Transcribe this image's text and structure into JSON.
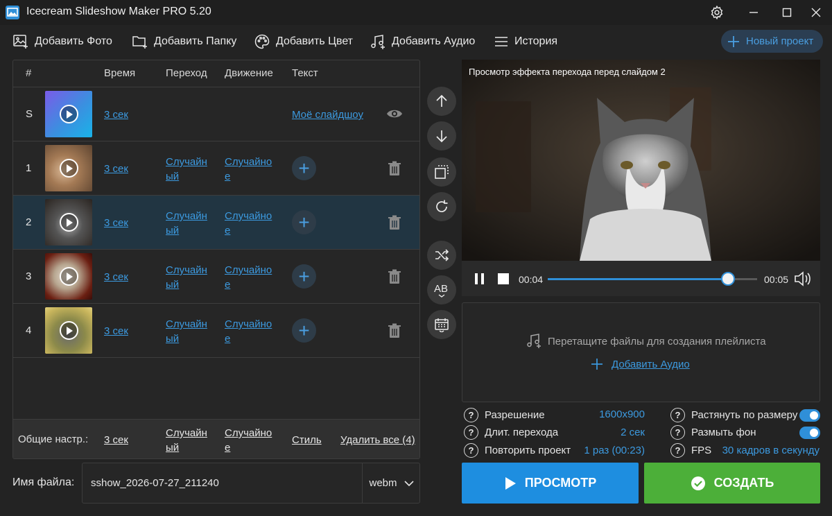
{
  "window": {
    "title": "Icecream Slideshow Maker PRO 5.20",
    "icons": [
      "app-icon",
      "gear-icon",
      "minimize-icon",
      "maximize-icon",
      "close-icon"
    ]
  },
  "toolbar": {
    "add_photo": "Добавить Фото",
    "add_folder": "Добавить Папку",
    "add_color": "Добавить Цвет",
    "add_audio": "Добавить Аудио",
    "history": "История",
    "new_project": "Новый проект"
  },
  "table": {
    "headers": {
      "num": "#",
      "time": "Время",
      "transition": "Переход",
      "motion": "Движение",
      "text": "Текст"
    },
    "start_row": {
      "num": "S",
      "time": "3 сек",
      "text": "Моё слайдшоу"
    },
    "rows": [
      {
        "num": "1",
        "time": "3 сек",
        "transition_a": "Случайн",
        "transition_b": "ый",
        "motion_a": "Случайно",
        "motion_b": "е"
      },
      {
        "num": "2",
        "time": "3 сек",
        "transition_a": "Случайн",
        "transition_b": "ый",
        "motion_a": "Случайно",
        "motion_b": "е"
      },
      {
        "num": "3",
        "time": "3 сек",
        "transition_a": "Случайн",
        "transition_b": "ый",
        "motion_a": "Случайно",
        "motion_b": "е"
      },
      {
        "num": "4",
        "time": "3 сек",
        "transition_a": "Случайн",
        "transition_b": "ый",
        "motion_a": "Случайно",
        "motion_b": "е"
      }
    ],
    "selected_row": "2",
    "footer": {
      "label": "Общие настр.:",
      "time": "3 сек",
      "transition_a": "Случайн",
      "transition_b": "ый",
      "motion_a": "Случайно",
      "motion_b": "е",
      "style": "Стиль",
      "delete_all": "Удалить все (4)"
    }
  },
  "file": {
    "label": "Имя файла:",
    "value": "sshow_2026-07-27_211240",
    "format": "webm"
  },
  "preview": {
    "caption": "Просмотр эффекта перехода перед слайдом 2",
    "time_current": "00:04",
    "time_total": "00:05",
    "progress": 0.86
  },
  "audio": {
    "drop_text": "Перетащите файлы для создания плейлиста",
    "add_audio": "Добавить Аудио"
  },
  "settings": {
    "resolution_label": "Разрешение",
    "resolution_value": "1600x900",
    "transition_len_label": "Длит. перехода",
    "transition_len_value": "2 сек",
    "repeat_label": "Повторить проект",
    "repeat_value": "1 раз (00:23)",
    "stretch_label": "Растянуть по размеру",
    "stretch_on": true,
    "blur_label": "Размыть фон",
    "blur_on": true,
    "fps_label": "FPS",
    "fps_value": "30 кадров в секунду"
  },
  "buttons": {
    "preview": "ПРОСМОТР",
    "create": "СОЗДАТЬ"
  },
  "colors": {
    "accent_blue": "#1e8ee0",
    "create_green": "#4caf39",
    "link_blue": "#3c9ae0"
  }
}
